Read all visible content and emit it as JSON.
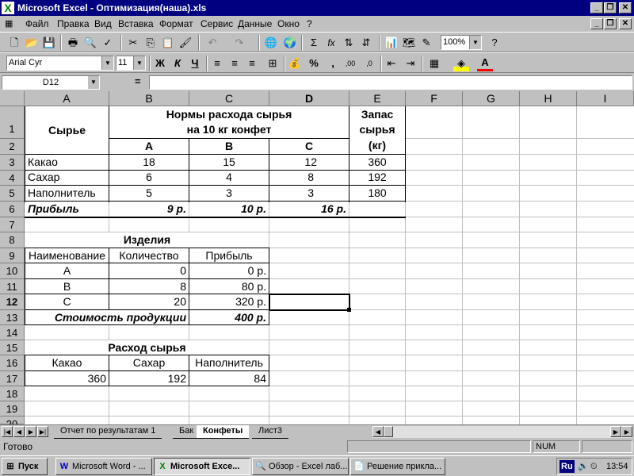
{
  "window": {
    "title": "Microsoft Excel - Оптимизация(наша).xls"
  },
  "menu": [
    {
      "label": "Файл"
    },
    {
      "label": "Правка"
    },
    {
      "label": "Вид"
    },
    {
      "label": "Вставка"
    },
    {
      "label": "Формат"
    },
    {
      "label": "Сервис"
    },
    {
      "label": "Данные"
    },
    {
      "label": "Окно"
    },
    {
      "label": "?"
    }
  ],
  "toolbar": {
    "zoom": "100%",
    "font_name": "Arial Cyr",
    "font_size": "11",
    "bold_label": "Ж",
    "italic_label": "К",
    "underline_label": "Ч",
    "percent_label": "%",
    "comma_label": ",",
    "sigma_label": "Σ",
    "fx_label": "fx"
  },
  "formula_bar": {
    "name_box": "D12",
    "eq": "=",
    "content": ""
  },
  "columns": [
    "A",
    "B",
    "C",
    "D",
    "E",
    "F",
    "G",
    "H",
    "I"
  ],
  "rows": [
    "1",
    "2",
    "3",
    "4",
    "5",
    "6",
    "7",
    "8",
    "9",
    "10",
    "11",
    "12",
    "13",
    "14",
    "15",
    "16",
    "17",
    "18",
    "19",
    "20"
  ],
  "cells": {
    "a1": "Сырье",
    "norms_l1": "Нормы расхода сырья",
    "norms_l2": "на 10 кг конфет",
    "stock_l1": "Запас",
    "stock_l2": "сырья",
    "stock_l3": "(кг)",
    "b2": "A",
    "c2": "B",
    "d2": "C",
    "a3": "Какао",
    "b3": "18",
    "c3": "15",
    "d3": "12",
    "e3": "360",
    "a4": "Сахар",
    "b4": "6",
    "c4": "4",
    "d4": "8",
    "e4": "192",
    "a5": "Наполнитель",
    "b5": "5",
    "c5": "3",
    "d5": "3",
    "e5": "180",
    "a6": "Прибыль",
    "b6": "9 р.",
    "c6": "10 р.",
    "d6": "16 р.",
    "b8": "Изделия",
    "a9": "Наименование",
    "b9": "Количество",
    "c9": "Прибыль",
    "a10": "A",
    "b10": "0",
    "c10": "0 р.",
    "a11": "B",
    "b11": "8",
    "c11": "80 р.",
    "a12": "C",
    "b12": "20",
    "c12": "320 р.",
    "ab13": "Стоимость продукции",
    "c13": "400 р.",
    "b15": "Расход сырья",
    "a16": "Какао",
    "b16": "Сахар",
    "c16": "Наполнитель",
    "a17": "360",
    "b17": "192",
    "c17": "84"
  },
  "sheets": [
    {
      "label": "Отчет по результатам 1"
    },
    {
      "label": "Бак"
    },
    {
      "label": "Конфеты"
    },
    {
      "label": "Лист3"
    }
  ],
  "status": {
    "ready": "Готово",
    "num": "NUM"
  },
  "taskbar": {
    "start": "Пуск",
    "items": [
      {
        "label": "Microsoft Word - ..."
      },
      {
        "label": "Microsoft Exce..."
      },
      {
        "label": "Обзор - Excel лаб..."
      },
      {
        "label": "Решение прикла..."
      }
    ],
    "lang": "Ru",
    "clock": "13:54"
  },
  "colors": {
    "titlebar": "#000080",
    "selection_border": "#000000"
  }
}
